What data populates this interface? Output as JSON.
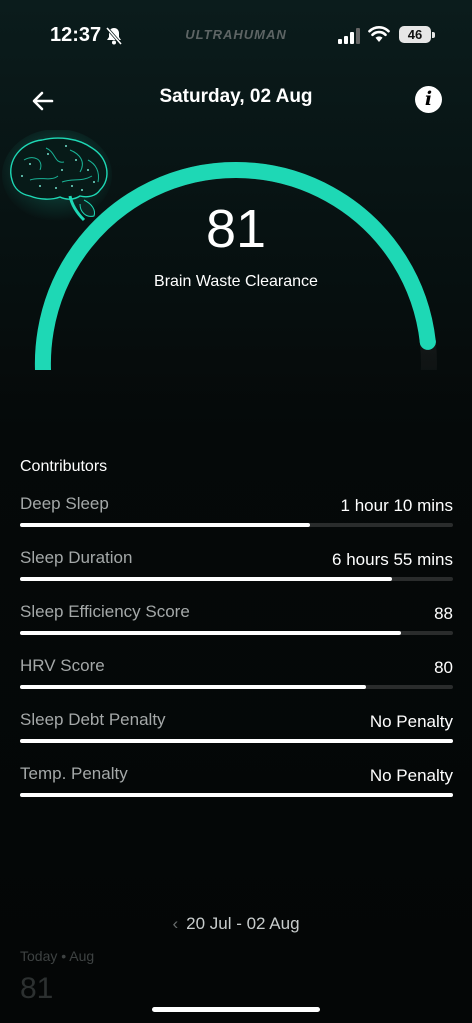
{
  "status_bar": {
    "time": "12:37",
    "brand": "ULTRAHUMAN",
    "battery": "46"
  },
  "header": {
    "title": "Saturday, 02 Aug"
  },
  "gauge": {
    "score": "81",
    "label": "Brain Waste Clearance",
    "score_fraction": 0.81,
    "accent_color": "#1ed8b5"
  },
  "contributors": {
    "title": "Contributors",
    "items": [
      {
        "label": "Deep Sleep",
        "value": "1 hour 10 mins",
        "fill": 0.67
      },
      {
        "label": "Sleep Duration",
        "value": "6 hours 55 mins",
        "fill": 0.86
      },
      {
        "label": "Sleep Efficiency Score",
        "value": "88",
        "fill": 0.88
      },
      {
        "label": "HRV Score",
        "value": "80",
        "fill": 0.8
      },
      {
        "label": "Sleep Debt Penalty",
        "value": "No Penalty",
        "fill": 1.0
      },
      {
        "label": "Temp. Penalty",
        "value": "No Penalty",
        "fill": 1.0
      }
    ]
  },
  "range": {
    "label": "20 Jul - 02 Aug"
  },
  "today": {
    "label": "Today • Aug",
    "value": "81"
  }
}
